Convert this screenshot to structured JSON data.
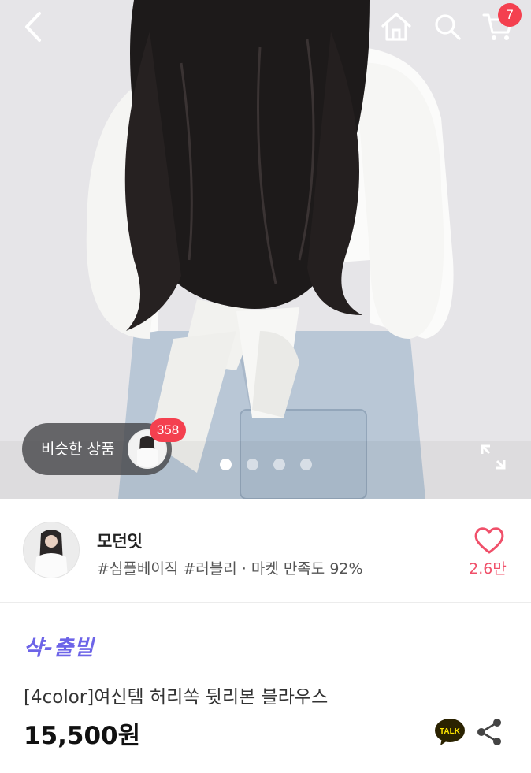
{
  "header": {
    "cart_count": "7"
  },
  "gallery": {
    "similar_label": "비슷한 상품",
    "similar_count": "358",
    "slides": 4,
    "active_slide": 1
  },
  "seller": {
    "name": "모던잇",
    "tags": "#심플베이직 #러블리 · 마켓 만족도 92%",
    "likes": "2.6만"
  },
  "product": {
    "shop_logo": "샥-출빌",
    "title": "[4color]여신템 허리쏙 뒷리본 블라우스",
    "price": "15,500원",
    "talk_label": "TALK"
  },
  "colors": {
    "accent_red": "#f4404f",
    "like_pink": "#f0506a",
    "shop_purple": "#6d64e8",
    "kakao_yellow": "#fee500"
  }
}
